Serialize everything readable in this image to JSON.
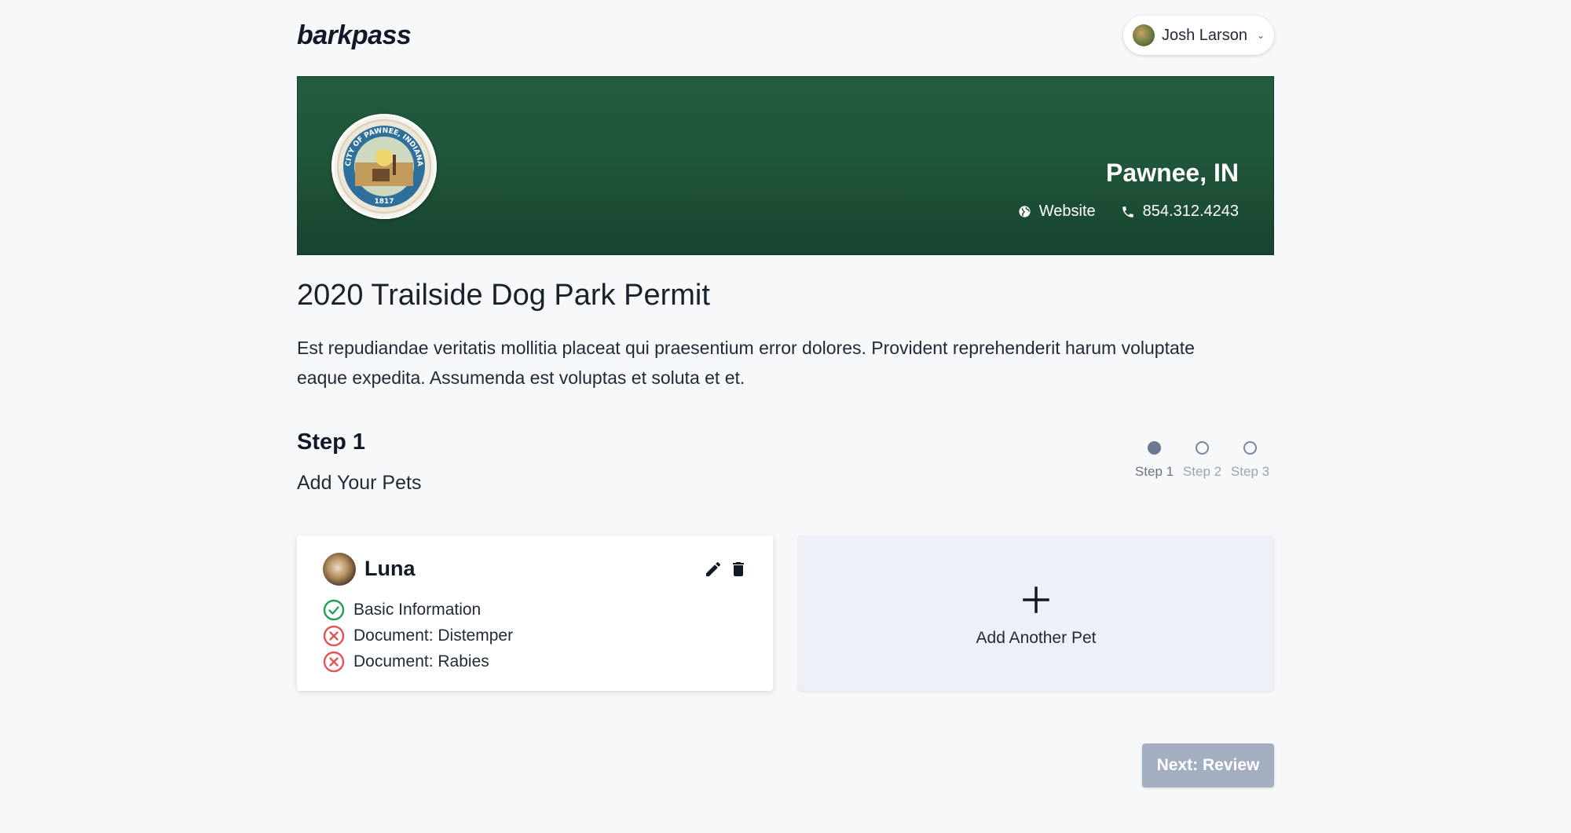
{
  "header": {
    "logo": "barkpass",
    "user": {
      "name": "Josh Larson"
    }
  },
  "banner": {
    "seal": {
      "top_text": "CITY OF PAWNEE, INDIANA",
      "year": "1817"
    },
    "city": "Pawnee, IN",
    "website_label": "Website",
    "phone": "854.312.4243"
  },
  "permit": {
    "title": "2020 Trailside Dog Park Permit",
    "description": "Est repudiandae veritatis mollitia placeat qui praesentium error dolores. Provident reprehenderit harum voluptate eaque expedita. Assumenda est voluptas et soluta et et."
  },
  "step": {
    "title": "Step 1",
    "subtitle": "Add Your Pets"
  },
  "stepper": [
    {
      "label": "Step 1",
      "active": true
    },
    {
      "label": "Step 2",
      "active": false
    },
    {
      "label": "Step 3",
      "active": false
    }
  ],
  "pet": {
    "name": "Luna",
    "checklist": [
      {
        "label": "Basic Information",
        "status": "complete"
      },
      {
        "label": "Document: Distemper",
        "status": "missing"
      },
      {
        "label": "Document: Rabies",
        "status": "missing"
      }
    ]
  },
  "add_pet": {
    "label": "Add Another Pet"
  },
  "next_button": {
    "label": "Next: Review"
  },
  "colors": {
    "banner_green": "#1f5439",
    "check_green": "#22a05a",
    "error_red": "#e05555",
    "button_disabled": "#a3afc1"
  }
}
